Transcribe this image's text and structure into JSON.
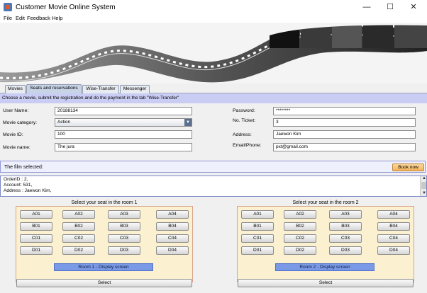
{
  "window": {
    "title": "Customer Movie Online System",
    "minimize": "—",
    "maximize": "☐",
    "close": "✕"
  },
  "menu": [
    "File",
    "Edit",
    "Feedback",
    "Help"
  ],
  "tabs": [
    "Movies",
    "Seats and reservations",
    "Wise-Transfer",
    "Messenger"
  ],
  "active_tab": "Seats and reservations",
  "instruction": "Choose a movie, submit the registration and do the payment in the tab \"Wise-Transfer\"",
  "form": {
    "username_label": "User Name:",
    "username_value": "20188134",
    "category_label": "Movie category:",
    "category_value": "Action",
    "movieid_label": "Movie ID:",
    "movieid_value": "100",
    "moviename_label": "Movie name:",
    "moviename_value": "The jura",
    "password_label": "Password:",
    "password_value": "********",
    "ticket_label": "No. Ticket:",
    "ticket_value": "3",
    "address_label": "Address:",
    "address_value": "Jaewon Kim",
    "email_label": "Email/Phone:",
    "email_value": "pxt@gmail.com"
  },
  "selected": {
    "label": "The film selected:",
    "book_label": "Book now"
  },
  "order": [
    "OrderID : 2,",
    "Account: 531,",
    "Address : Jaewon Kim,"
  ],
  "rooms": [
    {
      "title": "Select your seat in the room 1",
      "screen_label": "Room 1 - Display screen",
      "select_label": "Select",
      "rows": [
        [
          "A01",
          "A02",
          "A03",
          "A04"
        ],
        [
          "B01",
          "B02",
          "B03",
          "B04"
        ],
        [
          "C01",
          "C02",
          "C03",
          "C04"
        ],
        [
          "D01",
          "D02",
          "D03",
          "D04"
        ]
      ]
    },
    {
      "title": "Select your seat in the room 2",
      "screen_label": "Room 2 - Display screen",
      "select_label": "Select",
      "rows": [
        [
          "A01",
          "A02",
          "A03",
          "A04"
        ],
        [
          "B01",
          "B02",
          "B03",
          "B04"
        ],
        [
          "C01",
          "C02",
          "C03",
          "C04"
        ],
        [
          "D01",
          "D02",
          "D03",
          "D04"
        ]
      ]
    }
  ],
  "colors": {
    "instruction_bar": "#c9ccf3",
    "room_panel": "#fbf0d0",
    "screen_button": "#7a99e6",
    "book_button": "#f4b45a"
  }
}
